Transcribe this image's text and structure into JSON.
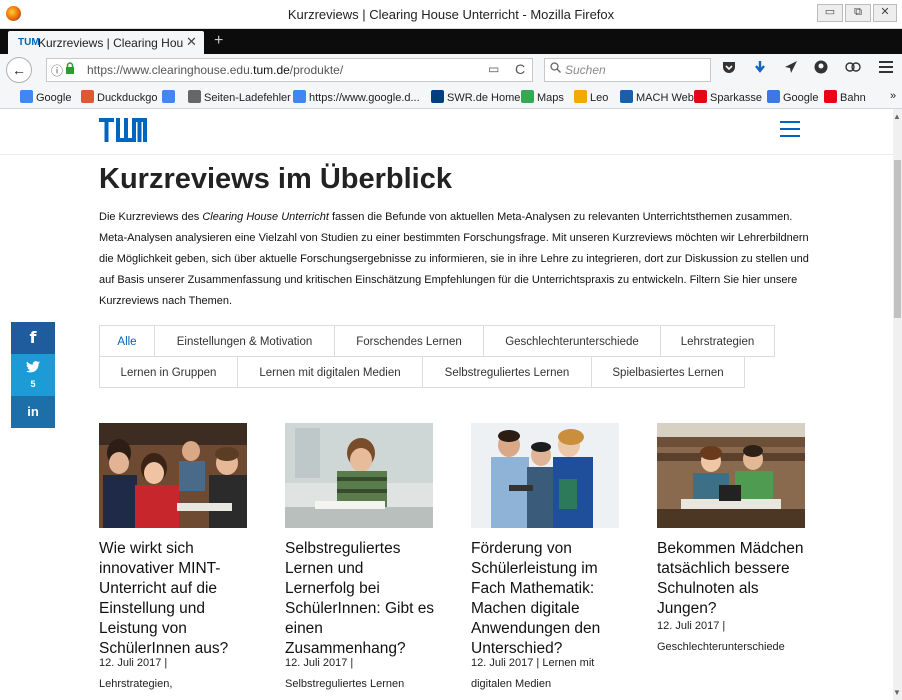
{
  "window": {
    "title": "Kurzreviews | Clearing House Unterricht - Mozilla Firefox",
    "btn_min": "▭",
    "btn_max": "⧉",
    "btn_close": "✕"
  },
  "tab": {
    "favicon": "TUM",
    "label": "Kurzreviews | Clearing House Unterricht",
    "close": "✕",
    "new": "+"
  },
  "nav": {
    "back": "←",
    "info": "ⓘ",
    "lock": "🔒",
    "url_prefix": "https://www.clearinghouse.edu.",
    "url_domain": "tum.de",
    "url_suffix": "/produkte/",
    "reader": "▭",
    "reload": "C",
    "search_icon": "🔍",
    "search_placeholder": "Suchen"
  },
  "toolbar_icons": [
    "pocket-icon",
    "download-icon",
    "send-icon",
    "avatar-icon",
    "extension-icon",
    "hamburger-menu-icon"
  ],
  "bookmarks": [
    {
      "label": "Google",
      "color": "#4285f4"
    },
    {
      "label": "Duckduckgo",
      "color": "#de5833"
    },
    {
      "label": "",
      "color": "#4285f4"
    },
    {
      "label": "Seiten-Ladefehler",
      "color": "#666666"
    },
    {
      "label": "https://www.google.d...",
      "color": "#4285f4"
    },
    {
      "label": "SWR.de Home",
      "color": "#003f7f"
    },
    {
      "label": "Maps",
      "color": "#34a853"
    },
    {
      "label": "Leo",
      "color": "#f2a900"
    },
    {
      "label": "MACH Web",
      "color": "#1a5fa8"
    },
    {
      "label": "Sparkasse",
      "color": "#e30613"
    },
    {
      "label": "Google",
      "color": "#3b78e7"
    },
    {
      "label": "Bahn",
      "color": "#ec0016"
    }
  ],
  "bookmark_overflow": "»",
  "site": {
    "logo": "TUM",
    "heading": "Kurzreviews im Überblick",
    "intro_before": "Die Kurzreviews des ",
    "intro_em": "Clearing House Unterricht",
    "intro_after": " fassen die Befunde von aktuellen Meta-Analysen zu relevanten Unterrichtsthemen zusammen. Meta-Analysen analysieren eine Vielzahl von Studien zu einer bestimmten Forschungsfrage. Mit unseren Kurzreviews möchten wir Lehrerbildnern die Möglichkeit geben, sich über aktuelle Forschungsergebnisse zu informieren, sie in ihre Lehre zu integrieren, dort zur Diskussion zu stellen und auf Basis unserer Zusammenfassung und kritischen Einschätzung Empfehlungen für die Unterrichtspraxis zu entwickeln. Filtern Sie hier unsere Kurzreviews nach Themen.",
    "filters_row1": [
      "Alle",
      "Einstellungen & Motivation",
      "Forschendes Lernen",
      "Geschlechterunterschiede",
      "Lehrstrategien"
    ],
    "filters_row2": [
      "Lernen in Gruppen",
      "Lernen mit digitalen Medien",
      "Selbstreguliertes Lernen",
      "Spielbasiertes Lernen"
    ],
    "accent": "#0065bd"
  },
  "social": {
    "facebook": "f",
    "twitter": "🐦",
    "twitter_count": "5",
    "linkedin": "in"
  },
  "cards": [
    {
      "title": "Wie wirkt sich innovativer MINT-Unterricht auf die Einstellung und Leistung von SchülerInnen aus?",
      "meta": "12. Juli 2017 | Lehrstrategien,"
    },
    {
      "title": "Selbstreguliertes Lernen und Lernerfolg bei SchülerInnen: Gibt es einen Zusammenhang?",
      "meta": "12. Juli 2017 | Selbstreguliertes Lernen"
    },
    {
      "title": "Förderung von Schülerleistung im Fach Mathematik: Machen digitale Anwendungen den Unterschied?",
      "meta": "12. Juli 2017 | Lernen mit digitalen Medien"
    },
    {
      "title": "Bekommen Mädchen tatsächlich bessere Schulnoten als Jungen?",
      "meta": "12. Juli 2017 | Geschlechterunterschiede"
    }
  ],
  "scroll": {
    "up": "▲",
    "down": "▼"
  }
}
